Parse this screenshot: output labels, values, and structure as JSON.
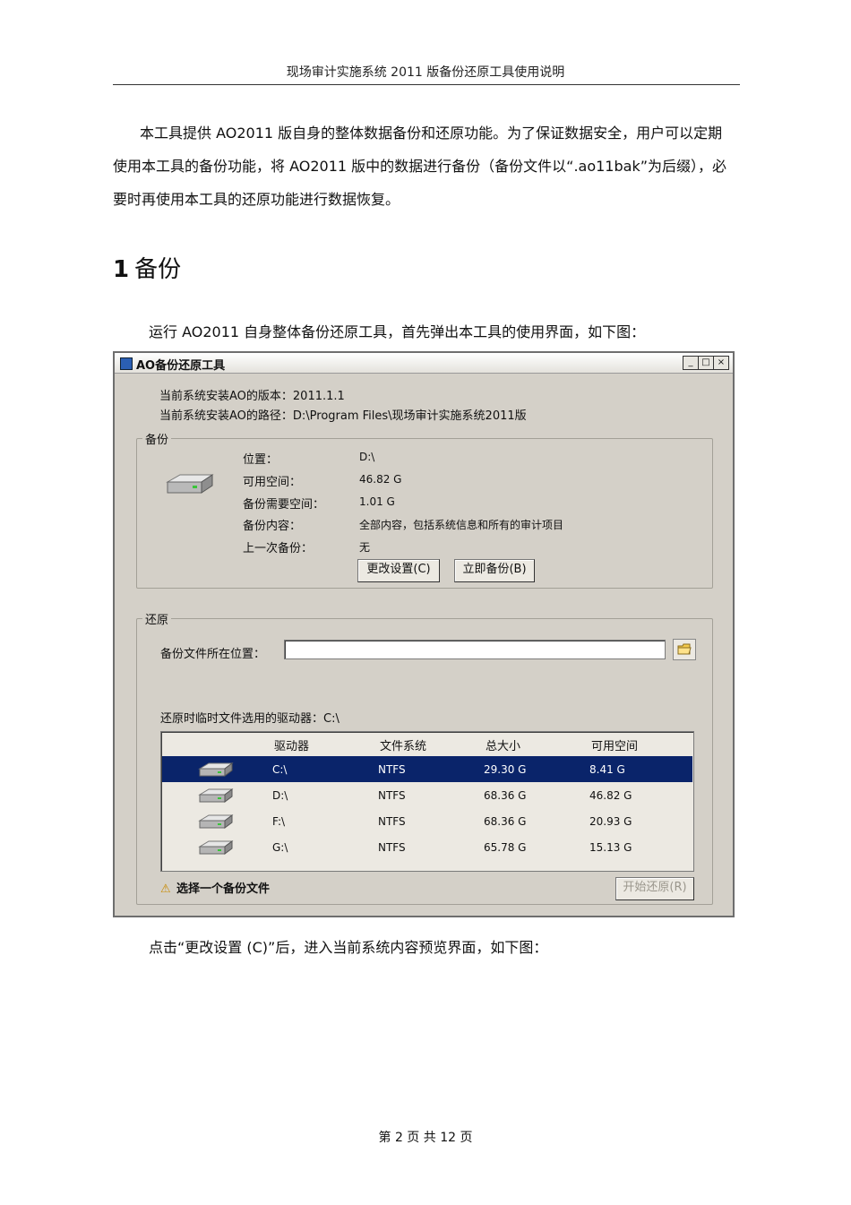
{
  "page": {
    "header": "现场审计实施系统    2011 版备份还原工具使用说明",
    "intro": "本工具提供  AO2011 版自身的整体数据备份和还原功能。为了保证数据安全，用户可以定期使用本工具的备份功能，将      AO2011  版中的数据进行备份（备份文件以“.ao11bak”为后缀），必要时再使用本工具的还原功能进行数据恢复。",
    "section_number": "1",
    "section_title": "备份",
    "caption1": "运行 AO2011 自身整体备份还原工具，首先弹出本工具的使用界面，如下图：",
    "caption2": "点击“更改设置 (C)”后，进入当前系统内容预览界面，如下图：",
    "footer": "第 2  页  共 12  页"
  },
  "window": {
    "title": "AO备份还原工具",
    "controls": {
      "min": "_",
      "max": "□",
      "close": "×"
    },
    "version_line": "当前系统安装AO的版本：2011.1.1",
    "path_line": "当前系统安装AO的路径：D:\\Program Files\\现场审计实施系统2011版",
    "backup": {
      "legend": "备份",
      "rows": [
        {
          "label": "位置：",
          "value": "D:\\"
        },
        {
          "label": "可用空间：",
          "value": "46.82 G"
        },
        {
          "label": "备份需要空间：",
          "value": "1.01 G"
        },
        {
          "label": "备份内容：",
          "value": "全部内容，包括系统信息和所有的审计项目"
        },
        {
          "label": "上一次备份：",
          "value": "无"
        }
      ],
      "change_button": "更改设置(C)",
      "backup_button": "立即备份(B)"
    },
    "restore": {
      "legend": "还原",
      "file_label": "备份文件所在位置：",
      "file_value": "",
      "temp_drive_label": "还原时临时文件选用的驱动器：C:\\",
      "columns": [
        "驱动器",
        "文件系统",
        "总大小",
        "可用空间"
      ],
      "drives": [
        {
          "drive": "C:\\",
          "fs": "NTFS",
          "total": "29.30 G",
          "free": "8.41 G",
          "selected": true
        },
        {
          "drive": "D:\\",
          "fs": "NTFS",
          "total": "68.36 G",
          "free": "46.82 G",
          "selected": false
        },
        {
          "drive": "F:\\",
          "fs": "NTFS",
          "total": "68.36 G",
          "free": "20.93 G",
          "selected": false
        },
        {
          "drive": "G:\\",
          "fs": "NTFS",
          "total": "65.78 G",
          "free": "15.13 G",
          "selected": false
        }
      ],
      "warning": "选择一个备份文件",
      "restore_button": "开始还原(R)"
    }
  }
}
